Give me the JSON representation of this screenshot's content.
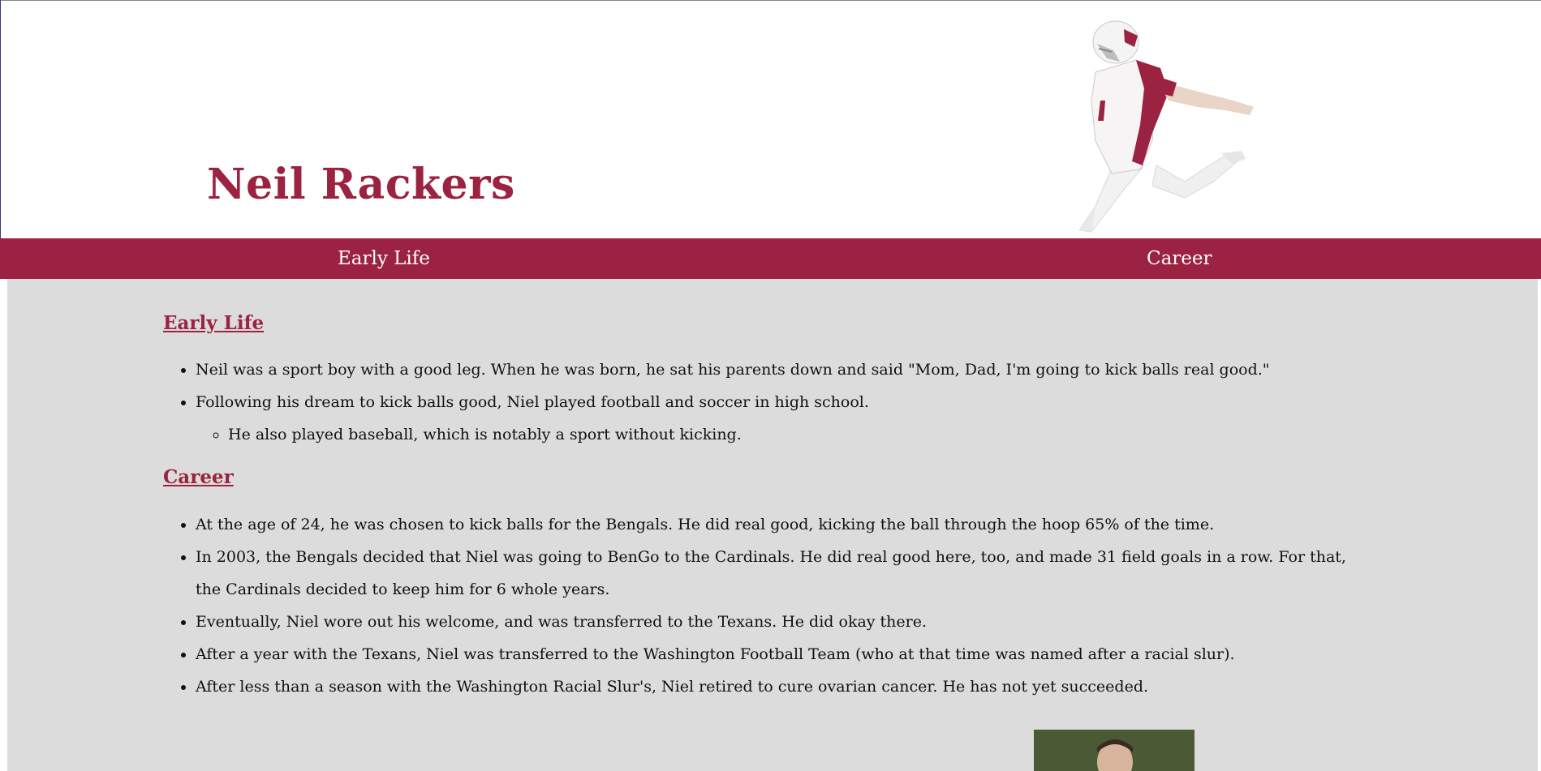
{
  "header": {
    "title": "Neil Rackers",
    "hero_image": "kicker-in-cardinals-uniform"
  },
  "nav": {
    "items": [
      {
        "label": "Early Life"
      },
      {
        "label": "Career"
      }
    ]
  },
  "sections": {
    "early_life": {
      "heading": "Early Life",
      "items": [
        "Neil was a sport boy with a good leg. When he was born, he sat his parents down and said \"Mom, Dad, I'm going to kick balls real good.\"",
        "Following his dream to kick balls good, Niel played football and soccer in high school."
      ],
      "sub_items": [
        "He also played baseball, which is notably a sport without kicking."
      ]
    },
    "career": {
      "heading": "Career",
      "items": [
        "At the age of 24, he was chosen to kick balls for the Bengals. He did real good, kicking the ball through the hoop 65% of the time.",
        "In 2003, the Bengals decided that Niel was going to BenGo to the Cardinals. He did real good here, too, and made 31 field goals in a row. For that, the Cardinals decided to keep him for 6 whole years.",
        "Eventually, Niel wore out his welcome, and was transferred to the Texans. He did okay there.",
        "After a year with the Texans, Niel was transferred to the Washington Football Team (who at that time was named after a racial slur).",
        "After less than a season with the Washington Racial Slur's, Niel retired to cure ovarian cancer. He has not yet succeeded."
      ]
    }
  },
  "colors": {
    "brand": "#9b2240",
    "content_bg": "#dcdcdc",
    "header_bg": "#ffffff"
  }
}
